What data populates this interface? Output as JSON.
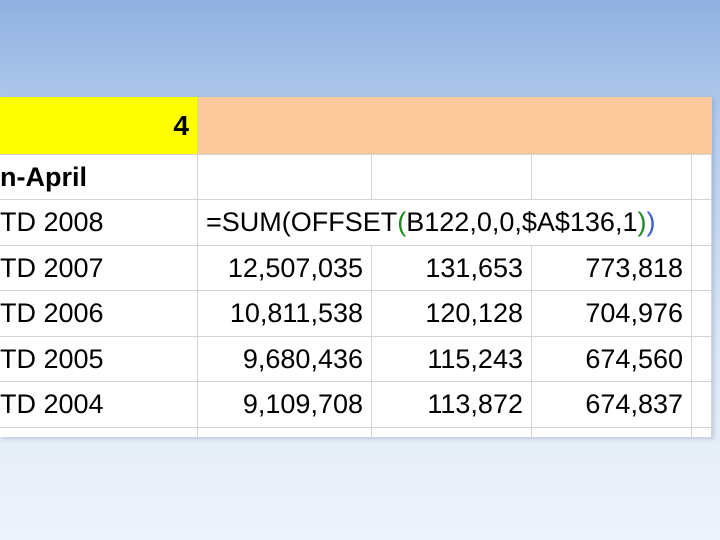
{
  "sheet": {
    "header_value": "4",
    "month_label": "n-April",
    "formula": {
      "prefix": "=SUM(OFFSET",
      "open_paren": "(",
      "args": "B122,0,0,$A$136,1",
      "close_paren_green": ")",
      "close_paren_outer": ")"
    },
    "rows": [
      {
        "label": "TD 2007",
        "c1": "12,507,035",
        "c2": "131,653",
        "c3": "773,818"
      },
      {
        "label": "TD 2006",
        "c1": "10,811,538",
        "c2": "120,128",
        "c3": "704,976"
      },
      {
        "label": "TD 2005",
        "c1": "9,680,436",
        "c2": "115,243",
        "c3": "674,560"
      },
      {
        "label": "TD 2004",
        "c1": "9,109,708",
        "c2": "113,872",
        "c3": "674,837"
      }
    ],
    "formula_row_label": "TD 2008"
  },
  "colors": {
    "header_yellow": "#ffff00",
    "header_peach": "#fcc99c",
    "formula_paren_green": "#1e8a1e",
    "formula_paren_blue": "#3a5fcd"
  }
}
